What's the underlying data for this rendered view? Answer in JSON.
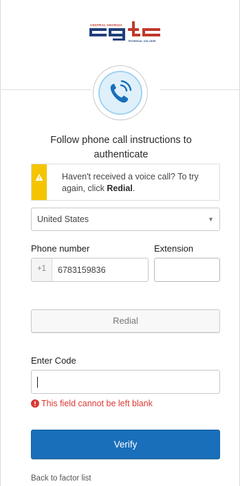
{
  "logo": {
    "top_text": "CENTRAL GEORGIA",
    "main_text": "cgtc",
    "bottom_text": "TECHNICAL COLLEGE",
    "colors": {
      "red": "#c0392b",
      "navy": "#1f3f7a"
    }
  },
  "factor": {
    "icon": "phone-call-icon",
    "color": "#1a6fba"
  },
  "title": "Follow phone call instructions to authenticate",
  "callout": {
    "text_before": "Haven't received a voice call? To try again, click ",
    "text_bold": "Redial",
    "text_after": ".",
    "icon": "warning-icon",
    "color": "#f5c400"
  },
  "country_select": {
    "value": "United States"
  },
  "phone": {
    "label": "Phone number",
    "prefix": "+1",
    "value": "6783159836"
  },
  "extension": {
    "label": "Extension",
    "value": ""
  },
  "redial_button": {
    "label": "Redial"
  },
  "code": {
    "label": "Enter Code",
    "value": "",
    "error": "This field cannot be left blank",
    "error_color": "#d93934"
  },
  "verify_button": {
    "label": "Verify",
    "color": "#1a6fba"
  },
  "back_link": "Back to factor list"
}
